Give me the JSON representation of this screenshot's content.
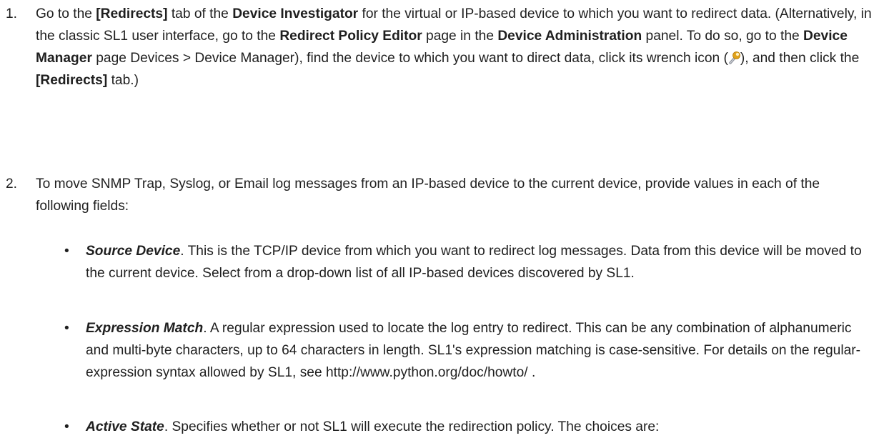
{
  "step1": {
    "number": "1.",
    "t1": "Go to the ",
    "redirects_tab": "[Redirects]",
    "t2": " tab of the ",
    "device_investigator": "Device Investigator",
    "t3": " for the virtual or IP-based device to which you want to redirect data. (Alternatively, in the classic SL1 user interface, go to the ",
    "redirect_policy_editor": "Redirect Policy Editor",
    "t4": " page in the ",
    "device_administration": "Device Administration",
    "t5": " panel. To do so, go to the ",
    "device_manager": "Device Manager",
    "t6": " page Devices > Device Manager), find the device to which you want to direct data, click its wrench icon (",
    "wrench_icon": "wrench-icon",
    "t7": "), and then click the ",
    "redirects_tab2": "[Redirects]",
    "t8": " tab.)"
  },
  "step2": {
    "number": "2.",
    "text": "To move SNMP Trap, Syslog, or Email log messages from an IP-based device to the current device, provide values in each of the following fields:"
  },
  "fields": [
    {
      "name": "Source Device",
      "text": ". This is the TCP/IP device from which you want to redirect log messages. Data from this device will be moved to the current device. Select from a drop-down list of all IP-based devices discovered by SL1."
    },
    {
      "name": "Expression Match",
      "text": ". A regular expression used to locate the log entry to redirect. This can be any combination of alphanumeric and multi-byte characters, up to 64 characters in length. SL1's expression matching is case-sensitive. For details on the regular-expression syntax allowed by SL1, see http://www.python.org/doc/howto/ ."
    },
    {
      "name": "Active State",
      "text": ". Specifies whether or not SL1 will execute the redirection policy. The choices are:"
    }
  ],
  "bullet_char": "•"
}
